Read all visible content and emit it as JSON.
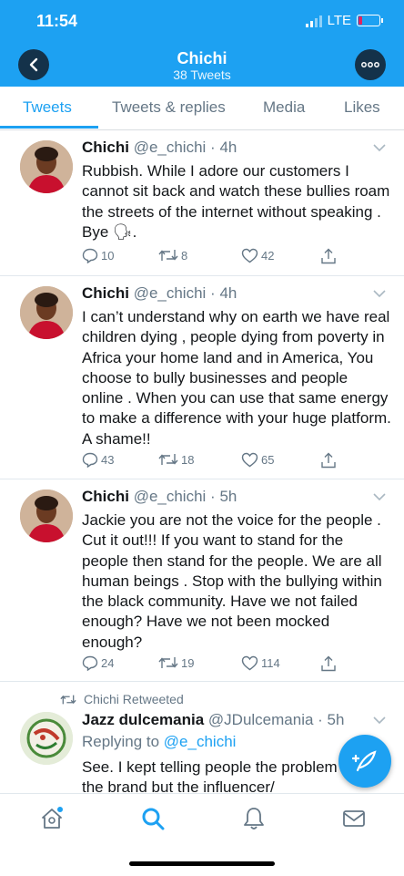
{
  "status": {
    "time": "11:54",
    "network": "LTE"
  },
  "header": {
    "title": "Chichi",
    "subtitle": "38 Tweets"
  },
  "tabs": [
    {
      "label": "Tweets",
      "active": true
    },
    {
      "label": "Tweets & replies"
    },
    {
      "label": "Media"
    },
    {
      "label": "Likes"
    }
  ],
  "tweets": [
    {
      "name": "Chichi",
      "handle": "@e_chichi",
      "time": "4h",
      "text": "Rubbish. While I adore our customers I cannot sit back and watch these bullies roam the streets of the internet without speaking . Bye 🗣.",
      "replies": "10",
      "retweets": "8",
      "likes": "42"
    },
    {
      "name": "Chichi",
      "handle": "@e_chichi",
      "time": "4h",
      "text": "I can’t understand why on earth we have real children dying , people dying from poverty in Africa your home land and in America, You choose to bully businesses and people online . When you can use that same energy to make a difference with your huge platform. A shame!!",
      "replies": "43",
      "retweets": "18",
      "likes": "65"
    },
    {
      "name": "Chichi",
      "handle": "@e_chichi",
      "time": "5h",
      "text": "Jackie you are not the voice for the people . Cut it out!!! If you want to stand for the people then stand for the people. We are all human beings . Stop with the bullying within the black community. Have we not failed enough? Have we not been mocked enough?",
      "replies": "24",
      "retweets": "19",
      "likes": "114"
    }
  ],
  "retweet": {
    "retweeted_label": "Chichi Retweeted",
    "name": "Jazz dulcemania",
    "handle": "@JDulcemania",
    "time": "5h",
    "replying_prefix": "Replying to",
    "replying_handle": "@e_chichi",
    "text": "See. I kept telling people the problem wasn't the brand but the influencer/"
  },
  "icons": {
    "back": "chevron-left-icon",
    "more": "ellipsis-icon",
    "reply": "reply-icon",
    "retweet": "retweet-icon",
    "like": "heart-icon",
    "share": "share-icon",
    "compose": "compose-feather-icon",
    "home": "home-icon",
    "search": "search-icon",
    "notifications": "bell-icon",
    "messages": "mail-icon"
  },
  "colors": {
    "accent": "#1da1f2",
    "text": "#14171a",
    "secondary": "#657786"
  }
}
